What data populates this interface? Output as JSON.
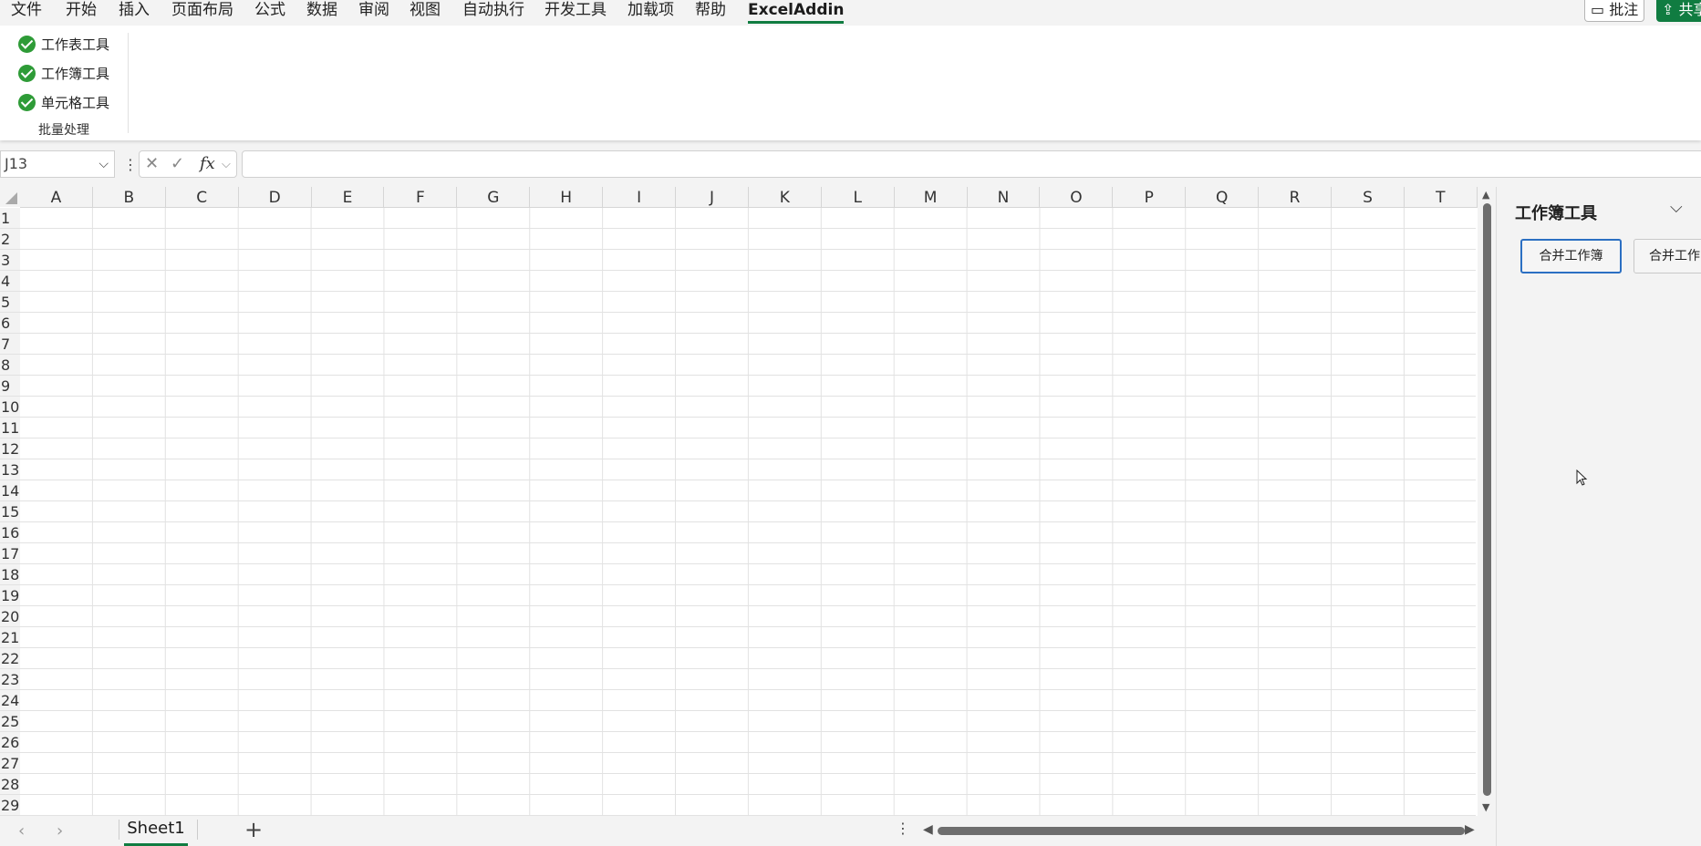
{
  "menu": {
    "items": [
      "文件",
      "开始",
      "插入",
      "页面布局",
      "公式",
      "数据",
      "审阅",
      "视图",
      "自动执行",
      "开发工具",
      "加载项",
      "帮助",
      "ExcelAddin"
    ],
    "active": "ExcelAddin",
    "comment_label": "批注",
    "share_label": "共享"
  },
  "ribbon": {
    "items": [
      "工作表工具",
      "工作簿工具",
      "单元格工具"
    ],
    "group_label": "批量处理",
    "icon": "check-circle-icon",
    "icon_color": "#2e9b37"
  },
  "formula_bar": {
    "namebox": "J13",
    "fx_label": "fx",
    "value": ""
  },
  "sheet": {
    "columns": [
      "A",
      "B",
      "C",
      "D",
      "E",
      "F",
      "G",
      "H",
      "I",
      "J",
      "K",
      "L",
      "M",
      "N",
      "O",
      "P",
      "Q",
      "R",
      "S",
      "T"
    ],
    "rows": [
      "1",
      "2",
      "3",
      "4",
      "5",
      "6",
      "7",
      "8",
      "9",
      "10",
      "11",
      "12",
      "13",
      "14",
      "15",
      "16",
      "17",
      "18",
      "19",
      "20",
      "21",
      "22",
      "23",
      "24",
      "25",
      "26",
      "27",
      "28",
      "29"
    ]
  },
  "tabs": {
    "sheets": [
      "Sheet1"
    ],
    "active": "Sheet1",
    "add_label": "+"
  },
  "task_pane": {
    "title": "工作簿工具",
    "buttons": [
      "合并工作簿",
      "合并工作"
    ]
  },
  "accent_color": "#107c41"
}
